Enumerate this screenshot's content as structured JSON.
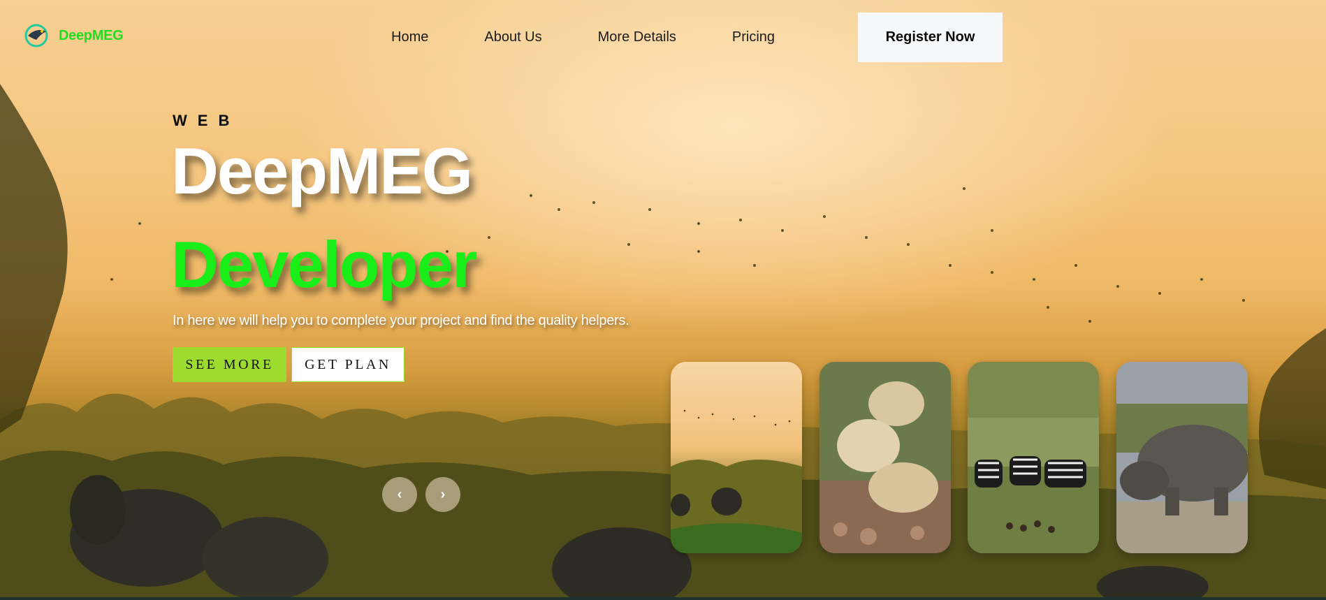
{
  "brand": {
    "name": "DeepMEG",
    "logo_icon": "eagle-globe-logo-icon",
    "color": "#22dd22"
  },
  "nav": {
    "links": [
      "Home",
      "About Us",
      "More Details",
      "Pricing"
    ],
    "cta_label": "Register Now"
  },
  "hero": {
    "eyebrow": "WEB",
    "headline_line1": "DeepMEG",
    "headline_line2": "Developer",
    "tagline": "In here we will help you to complete your project and find the quality helpers.",
    "primary_button": "SEE MORE",
    "secondary_button": "GET PLAN",
    "prev_icon": "chevron-left-icon",
    "next_icon": "chevron-right-icon",
    "prev_glyph": "‹",
    "next_glyph": "›"
  },
  "cards": [
    {
      "subject": "savanna-elephants-birds-thumbnail"
    },
    {
      "subject": "lions-resting-thumbnail"
    },
    {
      "subject": "zebras-grazing-thumbnail"
    },
    {
      "subject": "rhinoceros-thumbnail"
    }
  ],
  "colors": {
    "accent_green": "#19ee19",
    "button_green": "#9ddb2f",
    "sky_orange": "#f4c57e"
  }
}
